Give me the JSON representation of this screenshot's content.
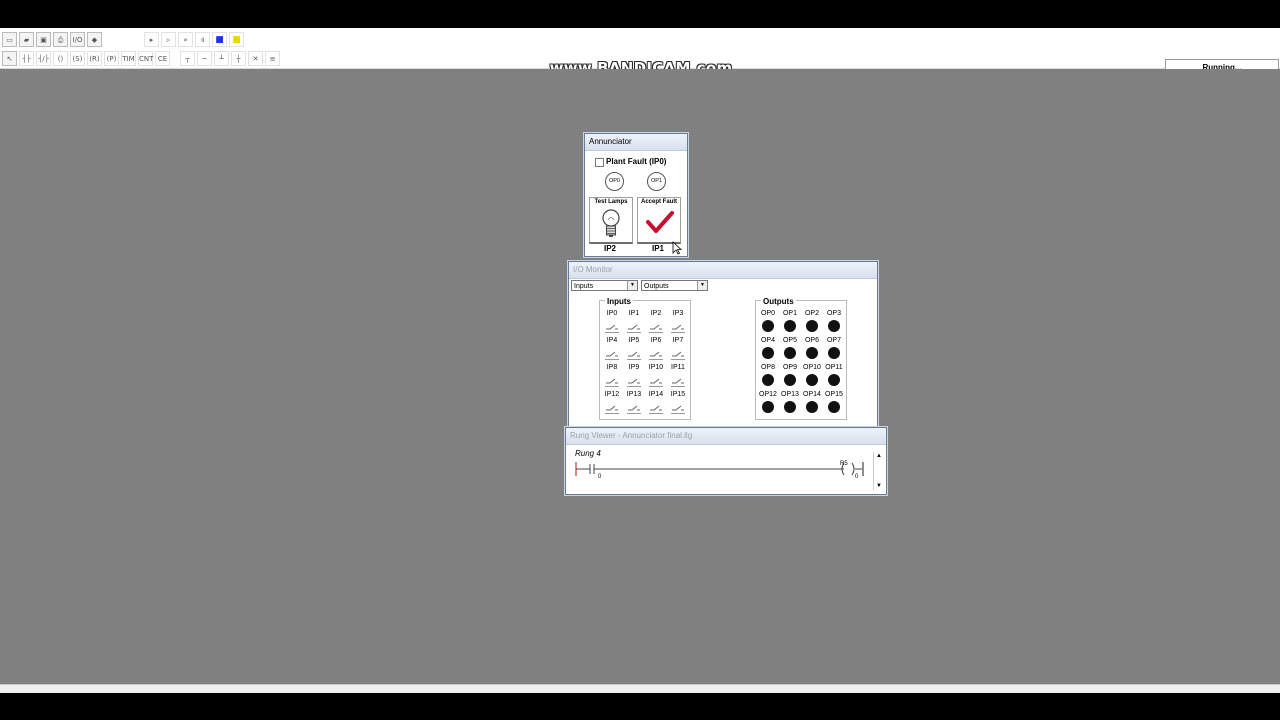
{
  "toolbar": {
    "row1": [
      "new-file",
      "open-folder",
      "save",
      "print",
      "io-mode",
      "eraser",
      "",
      "play",
      "step",
      "fast-forward",
      "pause",
      "stop",
      "highlight"
    ],
    "row2": [
      "pointer",
      "contact-no",
      "contact-nc",
      "coil",
      "set-coil",
      "reset-coil",
      "pulse",
      "timer",
      "counter",
      "compare",
      "branch",
      "wire",
      "delete"
    ],
    "io_label": "I/O",
    "timer_label": "TIM",
    "counter_label": "CNT",
    "compare_label": "CE",
    "status_text": "Running...",
    "stop_color": "#2233dd",
    "highlight_color": "#e8d800"
  },
  "watermark": "www.BANDICAM.com",
  "annunciator": {
    "title": "Annunciator",
    "checkbox_label": "Plant Fault (IP0)",
    "lamps": [
      "OP0",
      "OP1"
    ],
    "test_button": {
      "label": "Test Lamps",
      "input": "IP2"
    },
    "accept_button": {
      "label": "Accept Fault",
      "input": "IP1"
    }
  },
  "io_monitor": {
    "title": "I/O Monitor",
    "dropdown1": "Inputs",
    "dropdown2": "Outputs",
    "inputs_label": "Inputs",
    "outputs_label": "Outputs",
    "inputs": [
      "IP0",
      "IP1",
      "IP2",
      "IP3",
      "IP4",
      "IP5",
      "IP6",
      "IP7",
      "IP8",
      "IP9",
      "IP10",
      "IP11",
      "IP12",
      "IP13",
      "IP14",
      "IP15"
    ],
    "outputs": [
      "OP0",
      "OP1",
      "OP2",
      "OP3",
      "OP4",
      "OP5",
      "OP6",
      "OP7",
      "OP8",
      "OP9",
      "OP10",
      "OP11",
      "OP12",
      "OP13",
      "OP14",
      "OP15"
    ]
  },
  "rung_viewer": {
    "title": "Rung Viewer - Annunciator final.llg",
    "rung_label": "Rung 4",
    "contact_addr": "0",
    "coil_tag": "R5",
    "coil_addr": "0"
  }
}
